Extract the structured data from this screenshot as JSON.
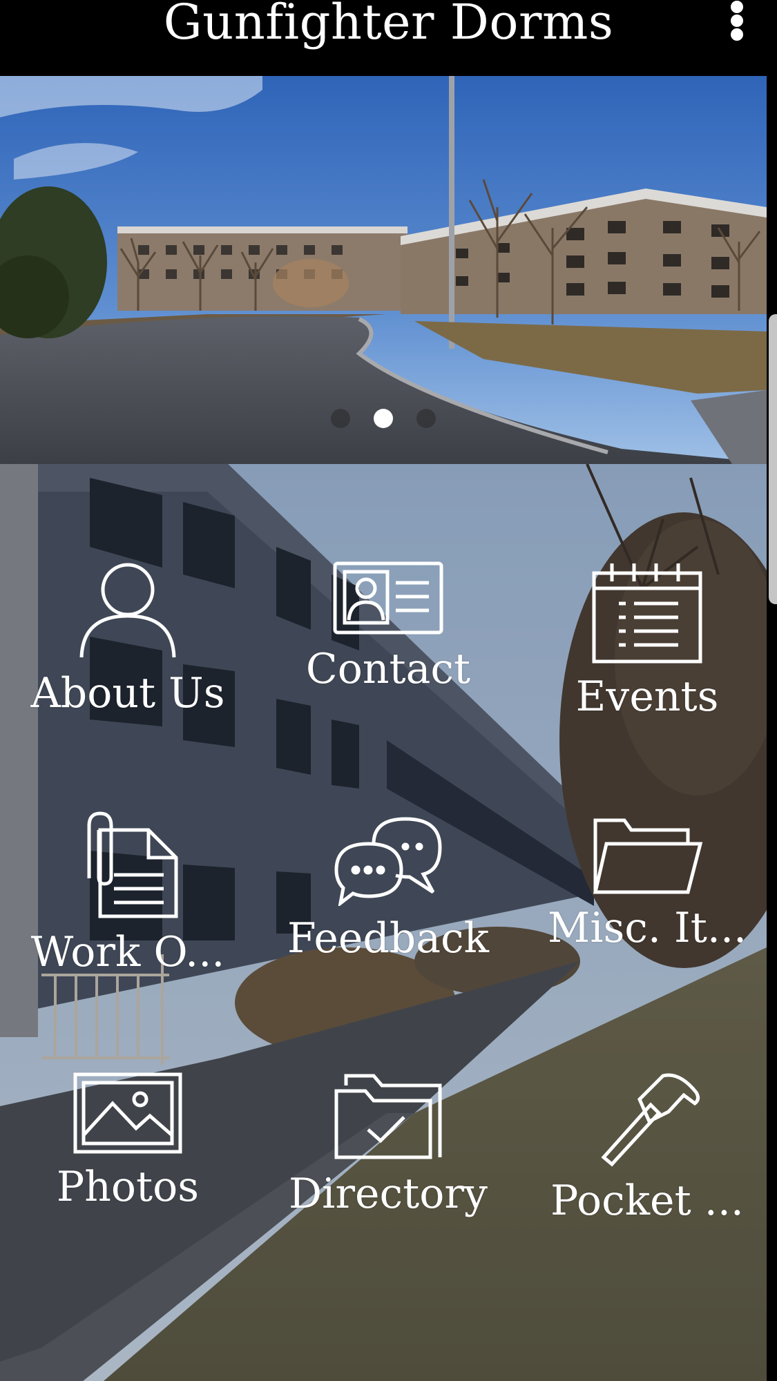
{
  "header": {
    "title": "Gunfighter Dorms",
    "menu_icon": "more-vert-icon"
  },
  "carousel": {
    "slide_count": 3,
    "active_index": 1
  },
  "menu": {
    "items": [
      {
        "label": "About Us",
        "icon": "person-icon"
      },
      {
        "label": "Contact",
        "icon": "id-card-icon"
      },
      {
        "label": "Events",
        "icon": "calendar-icon"
      },
      {
        "label": "Work O...",
        "icon": "document-paperclip-icon"
      },
      {
        "label": "Feedback",
        "icon": "chat-bubbles-icon"
      },
      {
        "label": "Misc. It...",
        "icon": "open-folder-icon"
      },
      {
        "label": "Photos",
        "icon": "image-icon"
      },
      {
        "label": "Directory",
        "icon": "folder-check-icon"
      },
      {
        "label": "Pocket ...",
        "icon": "hammer-icon"
      }
    ]
  },
  "colors": {
    "header_bg": "#000000",
    "icon_color": "#ffffff",
    "dot_active": "#ffffff",
    "dot_inactive": "#3a3a3a"
  }
}
